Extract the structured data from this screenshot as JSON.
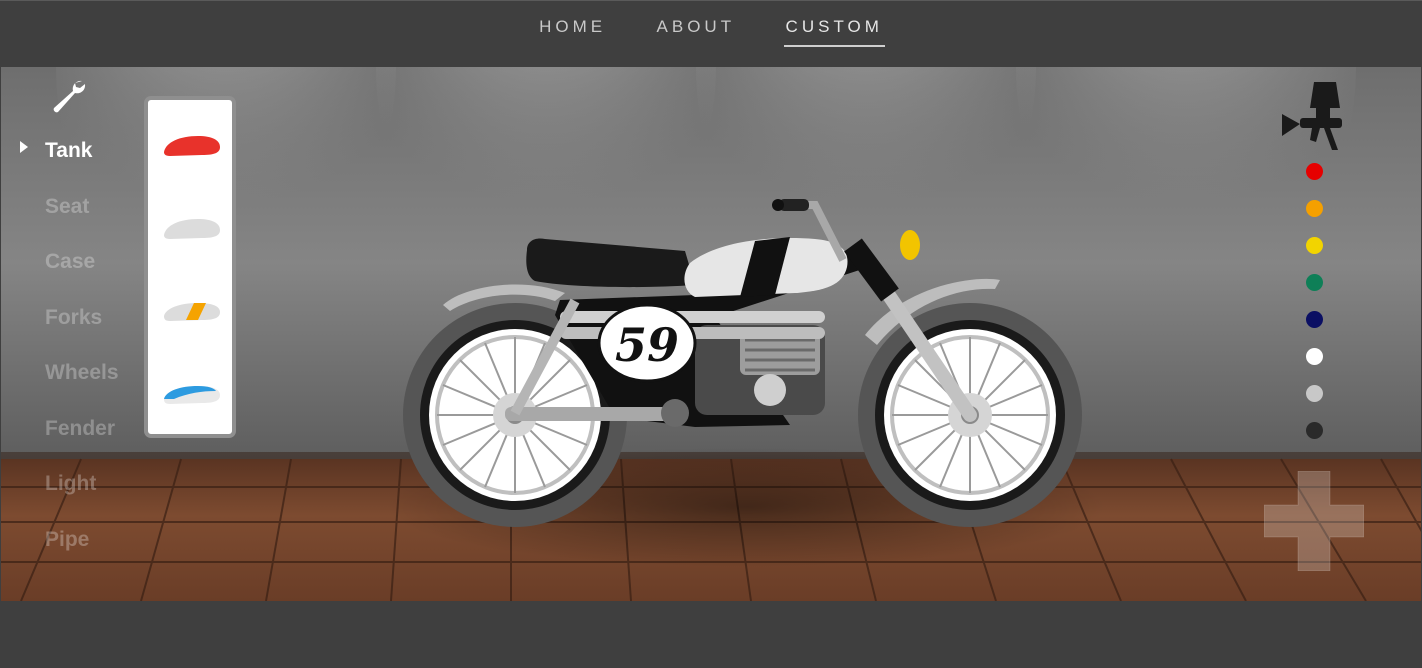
{
  "nav": {
    "items": [
      {
        "label": "HOME",
        "active": false
      },
      {
        "label": "ABOUT",
        "active": false
      },
      {
        "label": "CUSTOM",
        "active": true
      }
    ]
  },
  "tools": {
    "icon": "wrench-icon"
  },
  "parts": {
    "selected": "Tank",
    "items": [
      "Tank",
      "Seat",
      "Case",
      "Forks",
      "Wheels",
      "Fender",
      "Light",
      "Pipe"
    ]
  },
  "tank_options": [
    {
      "color": "#e8322b",
      "accent": "#e8322b"
    },
    {
      "color": "#dcdcdc",
      "accent": "#dcdcdc"
    },
    {
      "color": "#dcdcdc",
      "accent": "#f5a300"
    },
    {
      "color": "#e9e9e9",
      "accent": "#2d9be0"
    }
  ],
  "paint": {
    "icon": "spray-gun-icon",
    "colors": [
      "#e60000",
      "#f5a000",
      "#f2d400",
      "#0e7f57",
      "#0b0f63",
      "#ffffff",
      "#c8c8c8",
      "#2a2a2a"
    ]
  },
  "bike": {
    "number": "59"
  },
  "controls": {
    "icon": "dpad-icon"
  }
}
